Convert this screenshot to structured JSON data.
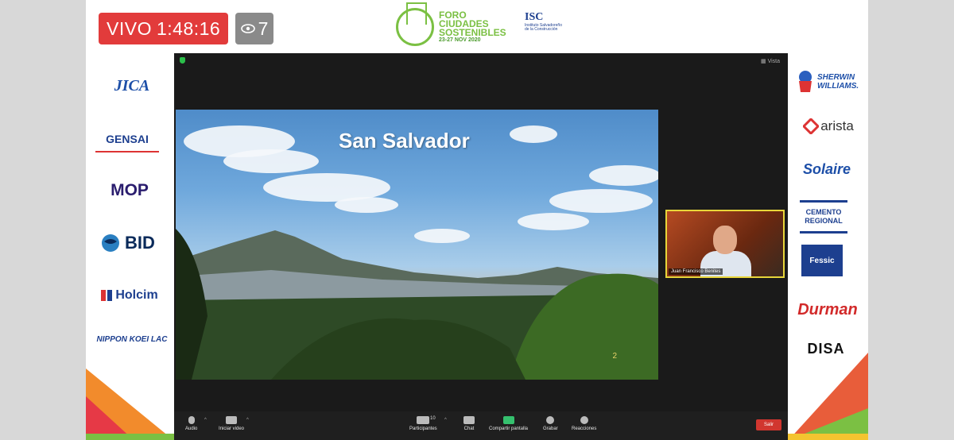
{
  "live": {
    "label": "VIVO",
    "timer": "1:48:16"
  },
  "viewers": {
    "count": "7",
    "icon": "eye-icon"
  },
  "header": {
    "foro_title": "FORO",
    "foro_line2": "CIUDADES",
    "foro_line3": "SOSTENIBLES",
    "foro_date": "23-27 NOV 2020",
    "isc": "ISC",
    "isc_sub": "Instituto Salvadoreño de la Construcción"
  },
  "sponsors_left": [
    "JICA",
    "GENSAI",
    "MOP",
    "BID",
    "Holcim",
    "NIPPON KOEI LAC"
  ],
  "sponsors_right": [
    "SHERWIN WILLIAMS.",
    "arista",
    "Solaire",
    "CEMENTO REGIONAL",
    "Fessic",
    "Durman",
    "DISA"
  ],
  "zoom": {
    "view_label": "Vista",
    "slide_title": "San Salvador",
    "slide_number": "2",
    "speaker_name": "Juan Francisco Benites",
    "toolbar": {
      "audio": "Audio",
      "video": "Iniciar video",
      "participants": "Participantes",
      "participants_count": "10",
      "chat": "Chat",
      "share": "Compartir pantalla",
      "record": "Grabar",
      "reactions": "Reacciones",
      "leave": "Salir"
    }
  },
  "colors": {
    "live_red": "#e23b3b",
    "accent_green": "#7bc043",
    "isc_blue": "#1d3f8f",
    "leave_red": "#d1362f"
  }
}
